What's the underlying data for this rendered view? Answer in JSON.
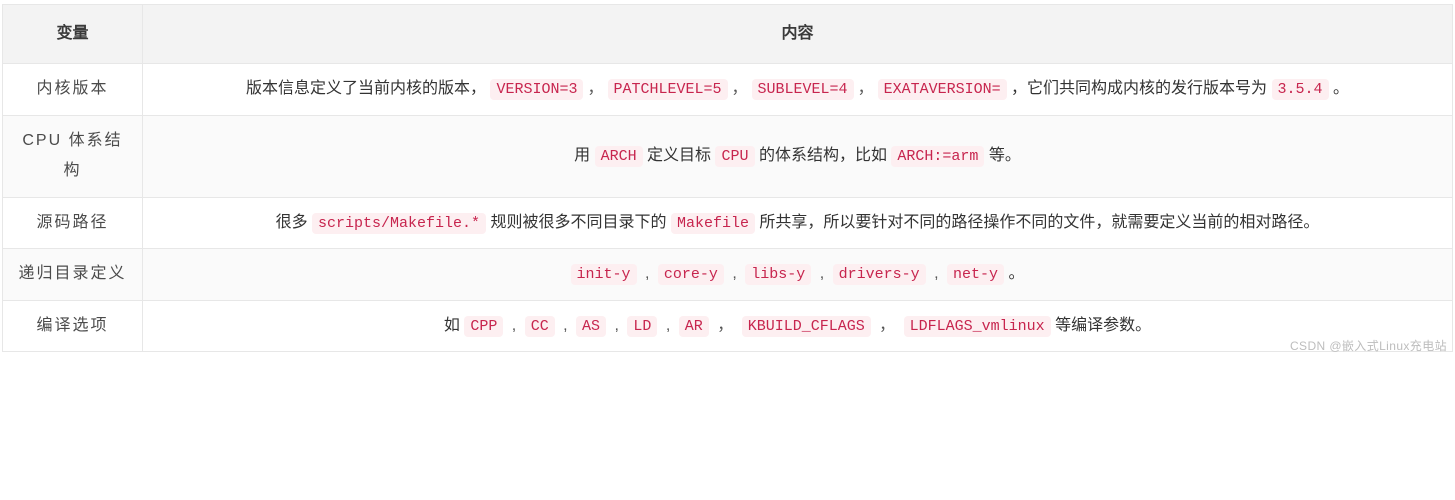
{
  "headers": {
    "var": "变量",
    "content": "内容"
  },
  "rows": [
    {
      "var": "内核版本",
      "segments": [
        {
          "t": "text",
          "v": "版本信息定义了当前内核的版本， "
        },
        {
          "t": "code",
          "v": "VERSION=3"
        },
        {
          "t": "sep",
          "v": "，"
        },
        {
          "t": "code",
          "v": "PATCHLEVEL=5"
        },
        {
          "t": "sep",
          "v": "，"
        },
        {
          "t": "code",
          "v": "SUBLEVEL=4"
        },
        {
          "t": "sep",
          "v": "，"
        },
        {
          "t": "code",
          "v": "EXATAVERSION="
        },
        {
          "t": "text",
          "v": " ，它们共同构成内核的发行版本号为 "
        },
        {
          "t": "code",
          "v": "3.5.4"
        },
        {
          "t": "text",
          "v": " 。"
        }
      ]
    },
    {
      "var": "CPU 体系结构",
      "segments": [
        {
          "t": "text",
          "v": "用 "
        },
        {
          "t": "code",
          "v": "ARCH"
        },
        {
          "t": "text",
          "v": " 定义目标 "
        },
        {
          "t": "code",
          "v": "CPU"
        },
        {
          "t": "text",
          "v": " 的体系结构，比如 "
        },
        {
          "t": "code",
          "v": "ARCH:=arm"
        },
        {
          "t": "text",
          "v": " 等。"
        }
      ]
    },
    {
      "var": "源码路径",
      "segments": [
        {
          "t": "text",
          "v": "很多 "
        },
        {
          "t": "code",
          "v": "scripts/Makefile.*"
        },
        {
          "t": "text",
          "v": " 规则被很多不同目录下的 "
        },
        {
          "t": "code",
          "v": "Makefile"
        },
        {
          "t": "text",
          "v": " 所共享，所以要针对不同的路径操作不同的文件，就需要定义当前的相对路径。"
        }
      ]
    },
    {
      "var": "递归目录定义",
      "segments": [
        {
          "t": "code",
          "v": "init-y"
        },
        {
          "t": "sep",
          "v": " , "
        },
        {
          "t": "code",
          "v": "core-y"
        },
        {
          "t": "sep",
          "v": " , "
        },
        {
          "t": "code",
          "v": "libs-y"
        },
        {
          "t": "sep",
          "v": " , "
        },
        {
          "t": "code",
          "v": "drivers-y"
        },
        {
          "t": "sep",
          "v": " , "
        },
        {
          "t": "code",
          "v": "net-y"
        },
        {
          "t": "text",
          "v": " 。"
        }
      ]
    },
    {
      "var": "编译选项",
      "segments": [
        {
          "t": "text",
          "v": "如 "
        },
        {
          "t": "code",
          "v": "CPP"
        },
        {
          "t": "sep",
          "v": " , "
        },
        {
          "t": "code",
          "v": "CC"
        },
        {
          "t": "sep",
          "v": " , "
        },
        {
          "t": "code",
          "v": "AS"
        },
        {
          "t": "sep",
          "v": " , "
        },
        {
          "t": "code",
          "v": "LD"
        },
        {
          "t": "sep",
          "v": " , "
        },
        {
          "t": "code",
          "v": "AR"
        },
        {
          "t": "sep",
          "v": " ， "
        },
        {
          "t": "code",
          "v": "KBUILD_CFLAGS"
        },
        {
          "t": "sep",
          "v": " ， "
        },
        {
          "t": "code",
          "v": "LDFLAGS_vmlinux"
        },
        {
          "t": "text",
          "v": " 等编译参数。"
        }
      ]
    }
  ],
  "watermark": "CSDN @嵌入式Linux充电站"
}
